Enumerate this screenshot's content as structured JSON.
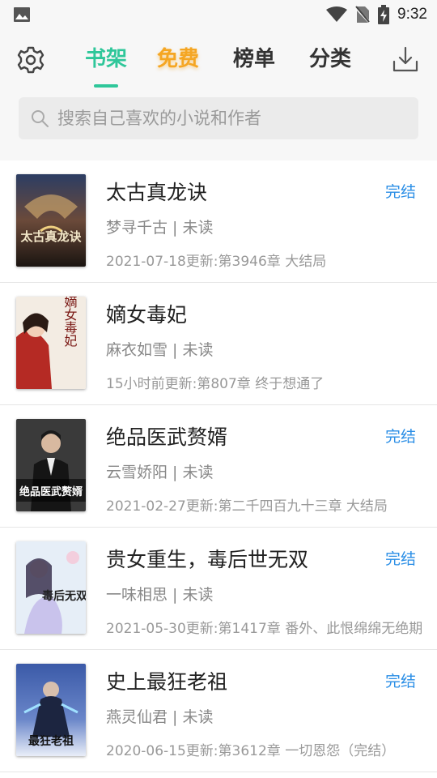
{
  "status_bar": {
    "time": "9:32"
  },
  "tabs": [
    {
      "label": "书架",
      "active": true
    },
    {
      "label": "免费",
      "highlight": "#f5a623"
    },
    {
      "label": "榜单"
    },
    {
      "label": "分类"
    }
  ],
  "search": {
    "placeholder": "搜索自己喜欢的小说和作者"
  },
  "books": [
    {
      "title": "太古真龙诀",
      "author": "梦寻千古",
      "read_status": "未读",
      "update": "2021-07-18更新:第3946章  大结局",
      "badge": "完结",
      "cover_text": "太古真龙诀"
    },
    {
      "title": "嫡女毒妃",
      "author": "麻衣如雪",
      "read_status": "未读",
      "update": "15小时前更新:第807章 终于想通了",
      "badge": "",
      "cover_text": "嫡女毒妃"
    },
    {
      "title": "绝品医武赘婿",
      "author": "云雪娇阳",
      "read_status": "未读",
      "update": "2021-02-27更新:第二千四百九十三章     大结局",
      "badge": "完结",
      "cover_text": "绝品医武赘婿"
    },
    {
      "title": "贵女重生，毒后世无双",
      "author": "一味相思",
      "read_status": "未读",
      "update": "2021-05-30更新:第1417章 番外、此恨绵绵无绝期",
      "badge": "完结",
      "cover_text": "毒后无双"
    },
    {
      "title": "史上最狂老祖",
      "author": "燕灵仙君",
      "read_status": "未读",
      "update": "2020-06-15更新:第3612章 一切恩怨（完结）",
      "badge": "完结",
      "cover_text": "最狂老祖"
    }
  ],
  "colors": {
    "accent": "#2fc79a",
    "free": "#f5a623",
    "badge": "#2a8ee6"
  }
}
